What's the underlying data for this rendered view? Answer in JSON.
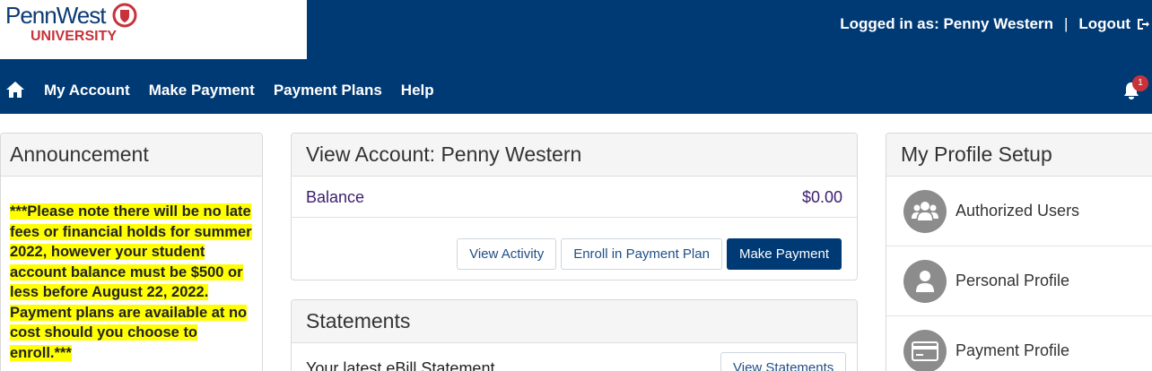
{
  "header": {
    "logo": {
      "brand": "PennWest",
      "sub": "UNIVERSITY"
    },
    "user": {
      "logged_in_text": "Logged in as: Penny Western",
      "separator": "|",
      "logout_label": "Logout"
    }
  },
  "nav": {
    "items": [
      {
        "label": "My Account"
      },
      {
        "label": "Make Payment"
      },
      {
        "label": "Payment Plans"
      },
      {
        "label": "Help"
      }
    ],
    "notification_count": "1"
  },
  "announcement": {
    "title": "Announcement",
    "text": "***Please note there will be no late fees or financial holds for summer 2022, however your student account balance must be $500 or less before August 22, 2022.  Payment plans are available at no cost should you choose to enroll.***"
  },
  "view_account": {
    "title": "View Account: Penny Western",
    "balance_label": "Balance",
    "balance_value": "$0.00",
    "buttons": {
      "view_activity": "View Activity",
      "enroll": "Enroll in Payment Plan",
      "make_payment": "Make Payment"
    }
  },
  "statements": {
    "title": "Statements",
    "latest_label": "Your latest eBill Statement",
    "view_button": "View Statements"
  },
  "profile_setup": {
    "title": "My Profile Setup",
    "items": [
      {
        "label": "Authorized Users",
        "icon": "users-icon"
      },
      {
        "label": "Personal Profile",
        "icon": "person-icon"
      },
      {
        "label": "Payment Profile",
        "icon": "credit-card-icon"
      }
    ]
  },
  "colors": {
    "brand_navy": "#003a75",
    "brand_red": "#c8323a",
    "balance_purple": "#3b1d6e",
    "highlight": "#ffff00"
  }
}
